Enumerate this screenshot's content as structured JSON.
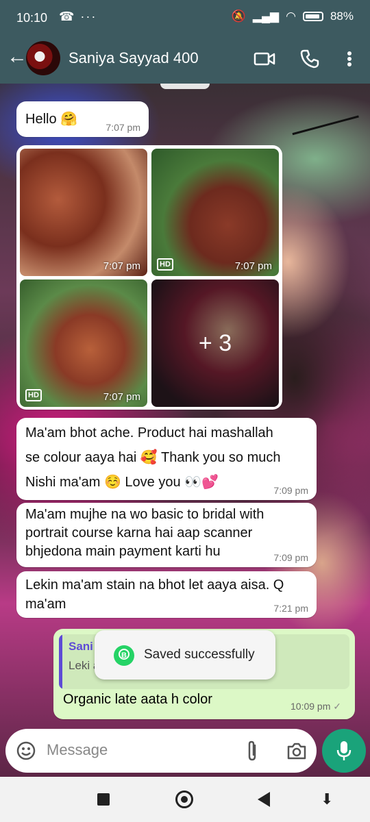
{
  "status_bar": {
    "time": "10:10",
    "left_icons": "☎ ···",
    "battery": "88%"
  },
  "header": {
    "contact_name": "Saniya Sayyad 400"
  },
  "messages": {
    "hello": {
      "text": "Hello 🤗",
      "time": "7:07 pm"
    },
    "album": {
      "photos": [
        {
          "time": "7:07 pm",
          "hd": ""
        },
        {
          "time": "7:07 pm",
          "hd": "HD"
        },
        {
          "time": "7:07 pm",
          "hd": "HD"
        }
      ],
      "more": "+ 3"
    },
    "m1": {
      "text": [
        "Ma'am bhot ache. Product hai mashallah",
        "se colour aaya hai 🥰 Thank you so much",
        "Nishi ma'am ☺️ Love you 👀💕"
      ],
      "time": "7:09 pm"
    },
    "m2": {
      "text": [
        "Ma'am mujhe na wo basic to bridal with",
        "portrait course karna hai aap scanner",
        "bhjedona main payment karti hu"
      ],
      "time": "7:09 pm"
    },
    "m3": {
      "text": [
        "Lekin ma'am stain na bhot let aaya aisa. Q",
        "ma'am"
      ],
      "time": "7:21 pm"
    },
    "outgoing": {
      "quote_name": "Sani",
      "quote_text": "Leki                                                  aisa. Q ma'am",
      "text": "Organic late aata h color",
      "time": "10:09 pm",
      "tick": "✓"
    }
  },
  "toast": {
    "text": "Saved successfully"
  },
  "composer": {
    "placeholder": "Message"
  },
  "colors": {
    "header": "#3d5a60",
    "outgoing": "#dcf8c6",
    "accent": "#1aa37a"
  }
}
